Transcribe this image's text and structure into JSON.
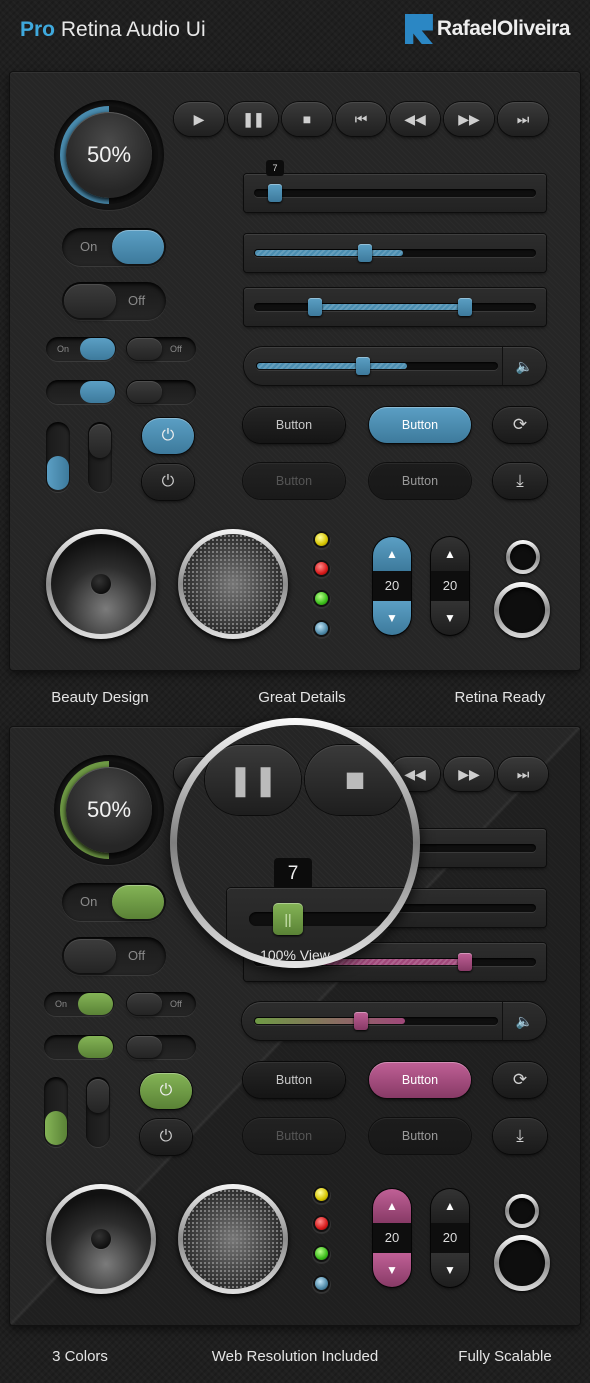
{
  "header": {
    "title_accent": "Pro",
    "title_rest": "Retina Audio Ui",
    "brand": "RafaelOliveira"
  },
  "panel_top": {
    "accent_color": "#4a8db0",
    "volume_knob": "50%",
    "toggle_on_label": "On",
    "toggle_off_label": "Off",
    "slider_tooltip": "7",
    "button_label": "Button",
    "stepper_values": [
      "20",
      "20"
    ]
  },
  "captions_top": [
    "Beauty Design",
    "Great Details",
    "Retina Ready"
  ],
  "panel_bottom": {
    "accent_color": "#6f9a45",
    "accent2_color": "#a0487a",
    "volume_knob": "50%",
    "toggle_on_label": "On",
    "toggle_off_label": "Off",
    "button_label": "Button",
    "stepper_values": [
      "20",
      "20"
    ],
    "magnifier_tooltip": "7",
    "magnifier_caption": "100% View"
  },
  "captions_bottom": [
    "3 Colors",
    "Web Resolution Included",
    "Fully Scalable"
  ],
  "icons": [
    "play-icon",
    "pause-icon",
    "stop-icon",
    "skip-back-icon",
    "rewind-icon",
    "fast-forward-icon",
    "skip-forward-icon",
    "speaker-icon",
    "power-icon",
    "refresh-icon",
    "download-icon",
    "arrow-up-icon",
    "arrow-down-icon"
  ]
}
